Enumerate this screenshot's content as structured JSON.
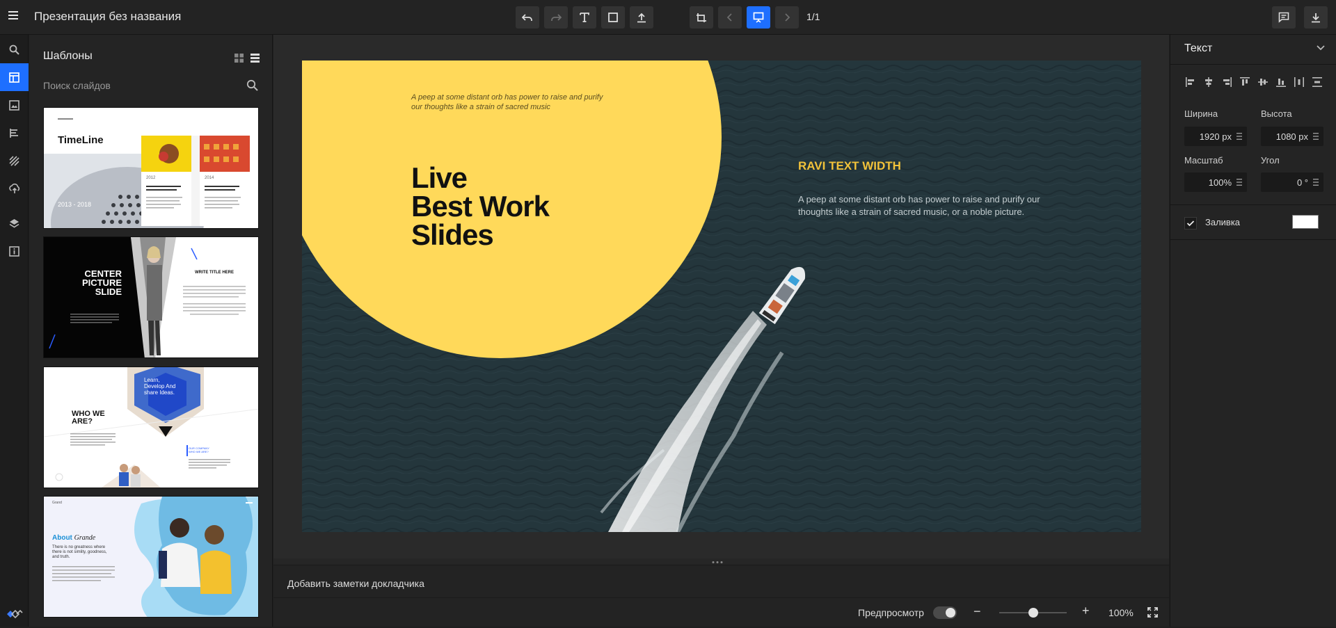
{
  "app": {
    "title": "Презентация без названия",
    "page_counter": "1/1"
  },
  "toolbar": {
    "items": [
      {
        "name": "undo-button",
        "icon": "undo-icon"
      },
      {
        "name": "redo-button",
        "icon": "redo-icon"
      },
      {
        "name": "text-button",
        "icon": "text-icon"
      },
      {
        "name": "shape-button",
        "icon": "square-icon"
      },
      {
        "name": "upload-button",
        "icon": "upload-icon"
      },
      {
        "name": "add-slide-button",
        "icon": "add-slide-icon"
      },
      {
        "name": "prev-slide-button",
        "icon": "chevron-left-icon"
      },
      {
        "name": "present-button",
        "icon": "presentation-icon"
      },
      {
        "name": "next-slide-button",
        "icon": "chevron-right-icon"
      }
    ],
    "right": [
      {
        "name": "comments-button",
        "icon": "comment-icon"
      },
      {
        "name": "download-button",
        "icon": "download-icon"
      }
    ],
    "accent": "#1e6fff"
  },
  "rail": {
    "items": [
      {
        "name": "search",
        "icon": "search-icon"
      },
      {
        "name": "templates",
        "icon": "layout-icon",
        "active": true
      },
      {
        "name": "images",
        "icon": "image-icon"
      },
      {
        "name": "text",
        "icon": "text-lines-icon"
      },
      {
        "name": "patterns",
        "icon": "pattern-icon"
      },
      {
        "name": "cloud",
        "icon": "cloud-upload-icon"
      },
      {
        "name": "layers",
        "icon": "layers-icon"
      },
      {
        "name": "info",
        "icon": "info-icon"
      }
    ],
    "bottom_icon": "logo-icon"
  },
  "templates": {
    "title": "Шаблоны",
    "search_placeholder": "Поиск слайдов",
    "thumbs": [
      {
        "title": "TimeLine",
        "years": "2013 - 2018",
        "year_a": "2012",
        "year_b": "2014"
      },
      {
        "title": "CENTER PICTURE SLIDE",
        "subtitle": "WRITE TITLE HERE"
      },
      {
        "title": "WHO WE ARE?",
        "badge": "Learn, Develop And share Ideas.",
        "tag": "OUR COMPANY WHO WE ARE?"
      },
      {
        "title": "About",
        "title_em": "Grande",
        "lead": "There is no greatness where there is not simlity, goodness, and truth.",
        "brand": "Grand"
      }
    ]
  },
  "slide": {
    "kicker": "A peep at some distant orb has power to raise and purify our thoughts like a strain of sacred music",
    "headline_1": "Live",
    "headline_2": "Best Work",
    "headline_3": "Slides",
    "heading_right": "RAVI TEXT WIDTH",
    "body_right": "A peep at some distant orb has power to raise and purify our thoughts like a strain of sacred music, or a noble picture.",
    "accent": "#ffd95a"
  },
  "notes": {
    "placeholder": "Добавить заметки докладчика"
  },
  "bottom": {
    "preview_label": "Предпросмотр",
    "zoom_value": "100%",
    "zoom_level": 0.5
  },
  "props": {
    "title": "Текст",
    "width_label": "Ширина",
    "height_label": "Высота",
    "width_value": "1920 px",
    "height_value": "1080 px",
    "scale_label": "Масштаб",
    "angle_label": "Угол",
    "scale_value": "100%",
    "angle_value": "0 °",
    "fill_label": "Заливка",
    "fill_checked": true,
    "fill_color": "#ffffff"
  }
}
